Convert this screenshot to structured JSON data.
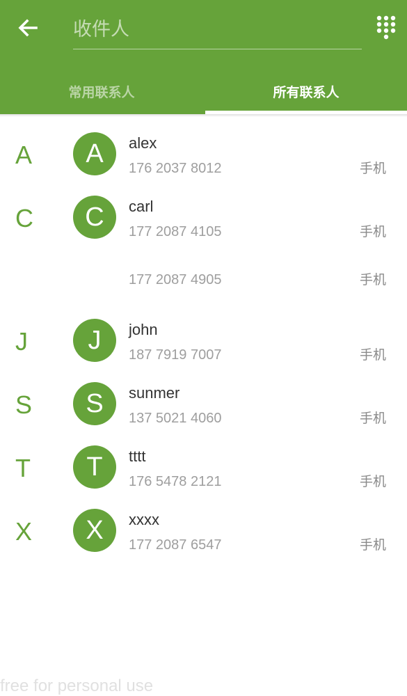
{
  "header": {
    "search_placeholder": "收件人",
    "tabs": [
      {
        "label": "常用联系人",
        "active": false
      },
      {
        "label": "所有联系人",
        "active": true
      }
    ],
    "colors": {
      "primary": "#66a33a"
    }
  },
  "icons": {
    "back": "arrow-left-icon",
    "dialpad": "dialpad-icon"
  },
  "contacts": [
    {
      "section": "A",
      "avatar": "A",
      "name": "alex",
      "phone": "176 2037 8012",
      "type": "手机"
    },
    {
      "section": "C",
      "avatar": "C",
      "name": "carl",
      "phone": "177 2087 4105",
      "type": "手机"
    },
    {
      "phone": "177 2087 4905",
      "type": "手机"
    },
    {
      "section": "J",
      "avatar": "J",
      "name": "john",
      "phone": "187 7919 7007",
      "type": "手机"
    },
    {
      "section": "S",
      "avatar": "S",
      "name": "sunmer",
      "phone": "137 5021 4060",
      "type": "手机"
    },
    {
      "section": "T",
      "avatar": "T",
      "name": "tttt",
      "phone": "176 5478 2121",
      "type": "手机"
    },
    {
      "section": "X",
      "avatar": "X",
      "name": "xxxx",
      "phone": "177 2087 6547",
      "type": "手机"
    }
  ],
  "watermark": "free for personal use"
}
